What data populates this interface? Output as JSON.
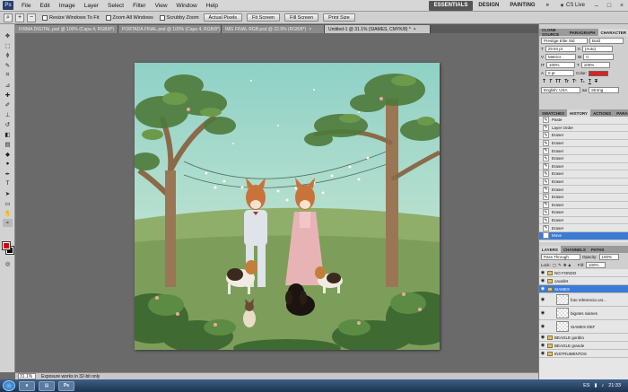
{
  "menubar": {
    "logo": "Ps",
    "items": [
      "File",
      "Edit",
      "Image",
      "Layer",
      "Select",
      "Filter",
      "View",
      "Window",
      "Help"
    ],
    "workspaces": [
      "ESSENTIALS",
      "DESIGN",
      "PAINTING",
      "»"
    ],
    "cs_live": "CS Live",
    "window_controls": [
      "–",
      "□",
      "×"
    ]
  },
  "options": {
    "resize_windows": "Resize Windows To Fit",
    "zoom_all": "Zoom All Windows",
    "scrubby": "Scrubby Zoom",
    "actual_pixels": "Actual Pixels",
    "fit_screen": "Fit Screen",
    "fill_screen": "Fill Screen",
    "print_size": "Print Size"
  },
  "tabs": [
    {
      "label": "FIRMA DIGITAL.psd @ 100% (Capa 4, RGB/8*)",
      "active": false
    },
    {
      "label": "PORTADA FINAL.psd @ 100% (Capa 4, RGB/8*)",
      "active": false
    },
    {
      "label": "IMG FINAL RGB.psd @ 22.9% (RGB/8*)",
      "active": false
    },
    {
      "label": "Untitled-1 @ 31.1% (SIAMES, CMYK/8) *",
      "active": true
    }
  ],
  "statusbar": {
    "zoom": "31.1%",
    "info": "Exposure works in 32-bit only"
  },
  "character": {
    "tabs": [
      "CLONE SOURCE",
      "PARAGRAPH",
      "CHARACTER"
    ],
    "font": "Prestige Elite Std",
    "style": "Bold",
    "size": "29.94 pt",
    "leading": "(Auto)",
    "kerning": "Metrics",
    "tracking": "0",
    "vscale": "100%",
    "hscale": "100%",
    "baseline": "0 pt",
    "color_label": "Color:",
    "language": "English: USA",
    "aa": "Strong",
    "accent": "#e02020"
  },
  "history": {
    "tabs": [
      "SWATCHES",
      "HISTORY",
      "ACTIONS",
      "PARAGRAPH"
    ],
    "items": [
      {
        "label": "Paste"
      },
      {
        "label": "Layer Order"
      },
      {
        "label": "Eraser"
      },
      {
        "label": "Eraser"
      },
      {
        "label": "Eraser"
      },
      {
        "label": "Eraser"
      },
      {
        "label": "Eraser"
      },
      {
        "label": "Eraser"
      },
      {
        "label": "Eraser"
      },
      {
        "label": "Eraser"
      },
      {
        "label": "Eraser"
      },
      {
        "label": "Eraser"
      },
      {
        "label": "Eraser"
      },
      {
        "label": "Eraser"
      },
      {
        "label": "Eraser"
      },
      {
        "label": "Move"
      }
    ],
    "selected_index": 15
  },
  "layers": {
    "tabs": [
      "LAYERS",
      "CHANNELS",
      "PATHS"
    ],
    "blend": "Pass Through",
    "opacity_label": "Opacity:",
    "opacity": "100%",
    "lock_label": "Lock:",
    "fill_label": "Fill:",
    "fill": "100%",
    "items": [
      {
        "label": "NO FONDO",
        "type": "group"
      },
      {
        "label": "cavallet",
        "type": "group"
      },
      {
        "label": "SIAMES",
        "type": "group",
        "selected": true
      },
      {
        "label": "foto referencia car...",
        "type": "pixel"
      },
      {
        "label": "bigotes siames",
        "type": "pixel"
      },
      {
        "label": "SIAMES DEF",
        "type": "pixel"
      },
      {
        "label": "BEAGLE gordito",
        "type": "group"
      },
      {
        "label": "BEAGLE grande",
        "type": "group"
      },
      {
        "label": "INSTRUMENTOS",
        "type": "group"
      }
    ]
  },
  "taskbar": {
    "apps": [
      "e",
      "▤",
      "Ps"
    ],
    "lang": "ES",
    "time": "21:33"
  }
}
